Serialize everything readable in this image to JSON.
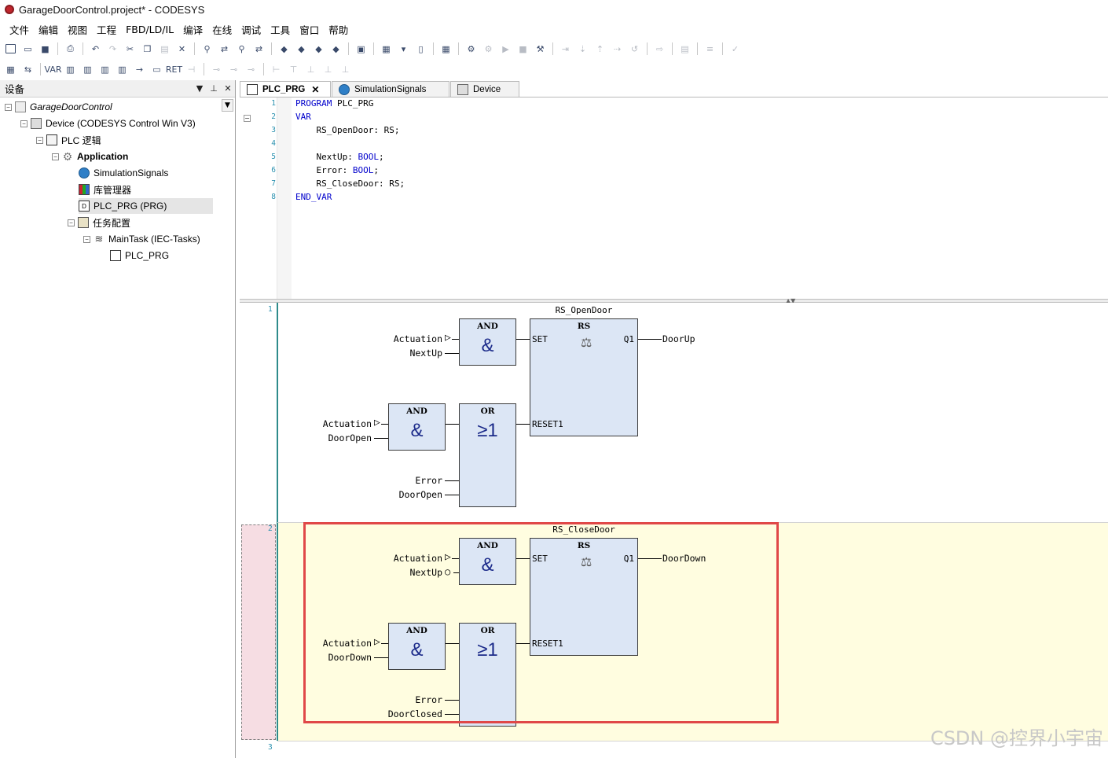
{
  "window": {
    "title": "GarageDoorControl.project* - CODESYS"
  },
  "menu": [
    "文件",
    "编辑",
    "视图",
    "工程",
    "FBD/LD/IL",
    "编译",
    "在线",
    "调试",
    "工具",
    "窗口",
    "帮助"
  ],
  "devices_panel": {
    "title": "设备",
    "tree": [
      {
        "label": "GarageDoorControl",
        "icon": "project-icon"
      },
      {
        "label": "Device (CODESYS Control Win V3)",
        "icon": "device-icon"
      },
      {
        "label": "PLC 逻辑",
        "icon": "plc-logic-icon"
      },
      {
        "label": "Application",
        "icon": "application-gear-icon"
      },
      {
        "label": "SimulationSignals",
        "icon": "visualization-globe-icon"
      },
      {
        "label": "库管理器",
        "icon": "library-manager-icon"
      },
      {
        "label": "PLC_PRG (PRG)",
        "icon": "pou-icon"
      },
      {
        "label": "任务配置",
        "icon": "task-config-icon"
      },
      {
        "label": "MainTask (IEC-Tasks)",
        "icon": "task-icon"
      },
      {
        "label": "PLC_PRG",
        "icon": "pou-call-icon"
      }
    ]
  },
  "tabs": [
    {
      "label": "PLC_PRG",
      "icon": "pou-icon",
      "active": true
    },
    {
      "label": "SimulationSignals",
      "icon": "visualization-globe-icon",
      "active": false
    },
    {
      "label": "Device",
      "icon": "device-icon",
      "active": false
    }
  ],
  "declaration": {
    "line_numbers": [
      "1",
      "2",
      "3",
      "4",
      "5",
      "6",
      "7",
      "8"
    ],
    "lines": [
      {
        "kw": "PROGRAM",
        "rest": " PLC_PRG"
      },
      {
        "kw": "VAR",
        "rest": ""
      },
      {
        "kw": "",
        "rest": "    RS_OpenDoor: RS;"
      },
      {
        "kw": "",
        "rest": ""
      },
      {
        "kw": "",
        "rest": "    NextUp: ",
        "type": "BOOL",
        "end": ";"
      },
      {
        "kw": "",
        "rest": "    Error: ",
        "type": "BOOL",
        "end": ";"
      },
      {
        "kw": "",
        "rest": "    RS_CloseDoor: RS;"
      },
      {
        "kw": "END_VAR",
        "rest": ""
      }
    ]
  },
  "fbd": {
    "networks": [
      {
        "number": "1",
        "instance": "RS_OpenDoor",
        "and1": {
          "type": "AND",
          "symbol": "&",
          "in1": "Actuation",
          "in2": "NextUp"
        },
        "and2": {
          "type": "AND",
          "symbol": "&",
          "in1": "Actuation",
          "in2": "DoorOpen"
        },
        "or": {
          "type": "OR",
          "symbol": "≥1",
          "in3": "Error",
          "in4": "DoorOpen"
        },
        "rs": {
          "type": "RS",
          "set": "SET",
          "reset": "RESET1",
          "q": "Q1",
          "output": "DoorUp"
        }
      },
      {
        "number": "2",
        "instance": "RS_CloseDoor",
        "and1": {
          "type": "AND",
          "symbol": "&",
          "in1": "Actuation",
          "in2": "NextUp"
        },
        "and2": {
          "type": "AND",
          "symbol": "&",
          "in1": "Actuation",
          "in2": "DoorDown"
        },
        "or": {
          "type": "OR",
          "symbol": "≥1",
          "in3": "Error",
          "in4": "DoorClosed"
        },
        "rs": {
          "type": "RS",
          "set": "SET",
          "reset": "RESET1",
          "q": "Q1",
          "output": "DoorDown"
        }
      },
      {
        "number": "3"
      }
    ]
  },
  "watermark": "CSDN @控界小宇宙",
  "colors": {
    "keyword": "#0000cc",
    "fb_fill": "#dce6f5",
    "highlight": "#e04848",
    "selected_network": "#fffde0"
  }
}
